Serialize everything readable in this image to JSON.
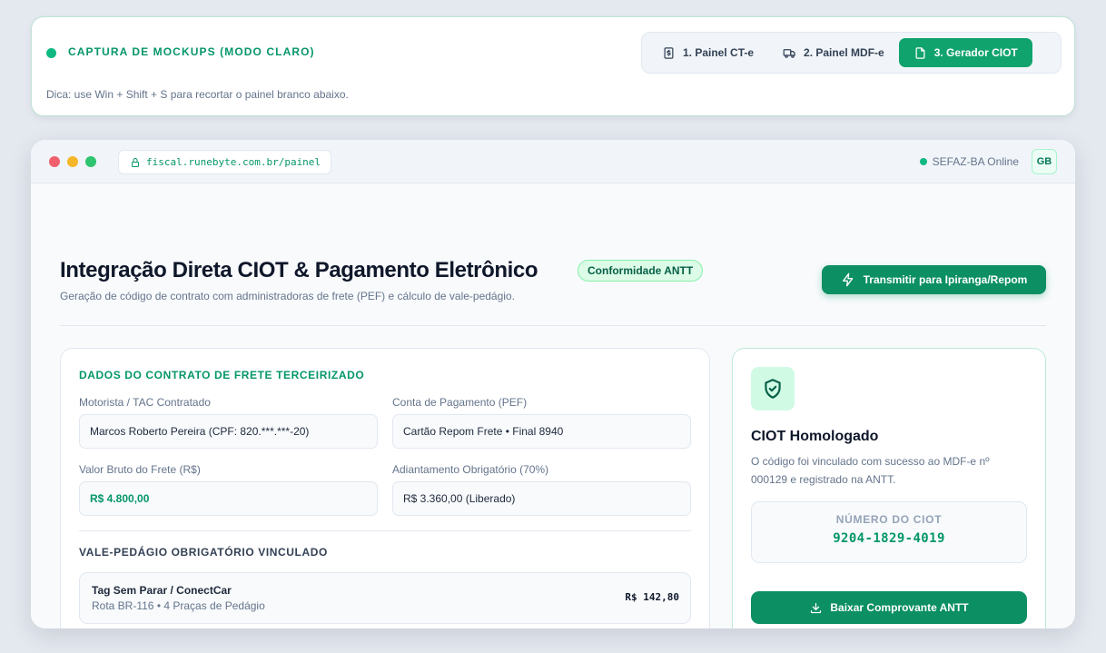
{
  "capture": {
    "title": "CAPTURA DE MOCKUPS (MODO CLARO)",
    "hint": "Dica: use Win + Shift + S para recortar o painel branco abaixo.",
    "tabs": [
      {
        "label": "1. Painel CT-e",
        "icon": "receipt-dollar-icon",
        "active": false
      },
      {
        "label": "2. Painel MDF-e",
        "icon": "truck-icon",
        "active": false
      },
      {
        "label": "3. Gerador CIOT",
        "icon": "document-icon",
        "active": true
      }
    ]
  },
  "browser": {
    "url": "fiscal.runebyte.com.br/painel",
    "status": "SEFAZ-BA Online",
    "avatar": "GB"
  },
  "header": {
    "title": "Integração Direta CIOT & Pagamento Eletrônico",
    "badge": "Conformidade ANTT",
    "subtitle": "Geração de código de contrato com administradoras de frete (PEF) e cálculo de vale-pedágio.",
    "action": "Transmitir para Ipiranga/Repom"
  },
  "contract": {
    "title": "DADOS DO CONTRATO DE FRETE TERCEIRIZADO",
    "driver_label": "Motorista / TAC Contratado",
    "driver_value": "Marcos Roberto Pereira (CPF: 820.***.***-20)",
    "account_label": "Conta de Pagamento (PEF)",
    "account_value": "Cartão Repom Frete • Final 8940",
    "gross_label": "Valor Bruto do Frete (R$)",
    "gross_value": "R$ 4.800,00",
    "advance_label": "Adiantamento Obrigatório (70%)",
    "advance_value": "R$ 3.360,00 (Liberado)",
    "toll": {
      "title": "VALE-PEDÁGIO OBRIGATÓRIO VINCULADO",
      "name": "Tag Sem Parar / ConectCar",
      "route": "Rota BR-116 • 4 Praças de Pedágio",
      "value": "R$ 142,80"
    }
  },
  "ciot": {
    "icon": "shield-check-icon",
    "title": "CIOT Homologado",
    "description": "O código foi vinculado com sucesso ao MDF-e nº 000129 e registrado na ANTT.",
    "number_label": "NÚMERO DO CIOT",
    "number": "9204-1829-4019",
    "download": "Baixar Comprovante ANTT"
  },
  "colors": {
    "accent": "#059669",
    "button": "#0b8f63",
    "background": "#e4e8ef"
  }
}
